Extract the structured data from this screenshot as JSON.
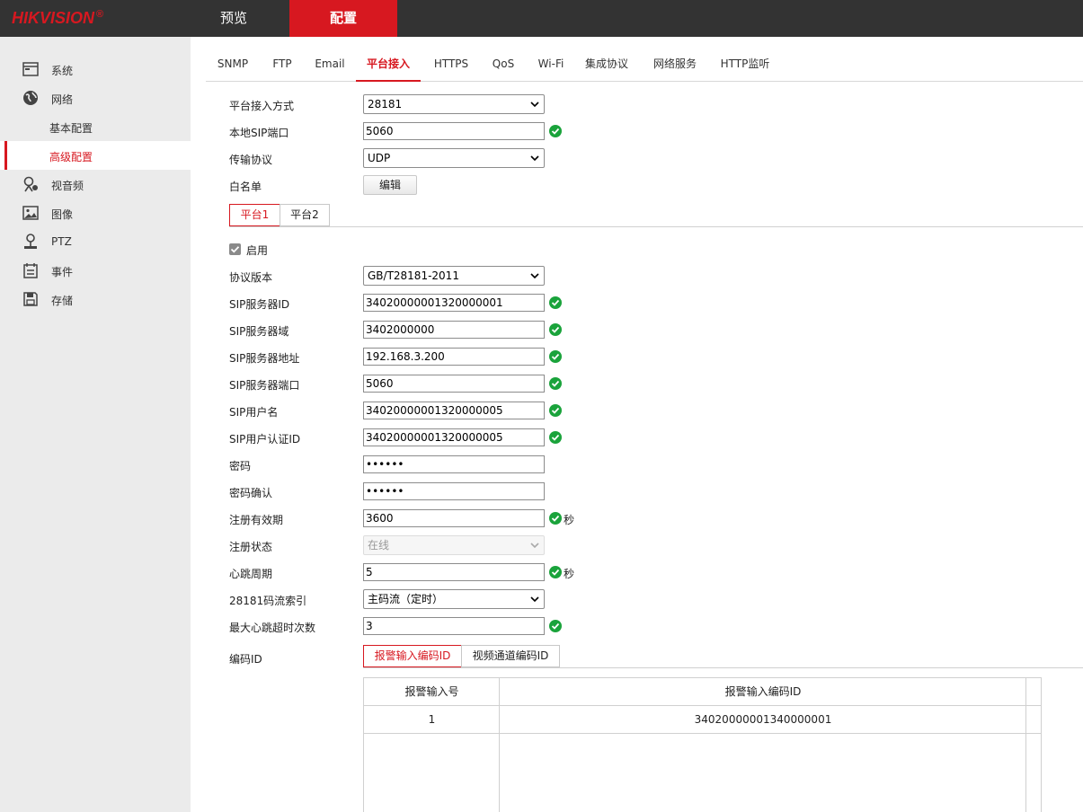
{
  "brand": {
    "logo": "HIKVISION",
    "reg": "®",
    "accent": "#d71820"
  },
  "topnav": {
    "preview": "预览",
    "config": "配置"
  },
  "sidebar": {
    "items": [
      {
        "label": "系统",
        "icon": "system-icon"
      },
      {
        "label": "网络",
        "icon": "network-icon"
      },
      {
        "label": "基本配置",
        "sub": true
      },
      {
        "label": "高级配置",
        "sub": true,
        "active": true
      },
      {
        "label": "视音频",
        "icon": "video-audio-icon"
      },
      {
        "label": "图像",
        "icon": "image-icon"
      },
      {
        "label": "PTZ",
        "icon": "ptz-icon"
      },
      {
        "label": "事件",
        "icon": "event-icon"
      },
      {
        "label": "存储",
        "icon": "storage-icon"
      }
    ]
  },
  "tabs": [
    "SNMP",
    "FTP",
    "Email",
    "平台接入",
    "HTTPS",
    "QoS",
    "Wi-Fi",
    "集成协议",
    "网络服务",
    "HTTP监听"
  ],
  "active_tab": "平台接入",
  "form": {
    "access_mode": {
      "label": "平台接入方式",
      "value": "28181"
    },
    "local_sip_port": {
      "label": "本地SIP端口",
      "value": "5060"
    },
    "transport": {
      "label": "传输协议",
      "value": "UDP"
    },
    "whitelist": {
      "label": "白名单",
      "button": "编辑"
    },
    "platform_tabs": [
      "平台1",
      "平台2"
    ],
    "enable": {
      "label": "启用",
      "checked": true
    },
    "protocol_version": {
      "label": "协议版本",
      "value": "GB/T28181-2011"
    },
    "sip_server_id": {
      "label": "SIP服务器ID",
      "value": "34020000001320000001"
    },
    "sip_server_domain": {
      "label": "SIP服务器域",
      "value": "3402000000"
    },
    "sip_server_addr": {
      "label": "SIP服务器地址",
      "value": "192.168.3.200"
    },
    "sip_server_port": {
      "label": "SIP服务器端口",
      "value": "5060"
    },
    "sip_username": {
      "label": "SIP用户名",
      "value": "34020000001320000005"
    },
    "sip_auth_id": {
      "label": "SIP用户认证ID",
      "value": "34020000001320000005"
    },
    "password": {
      "label": "密码",
      "value": "••••••"
    },
    "password_confirm": {
      "label": "密码确认",
      "value": "••••••"
    },
    "reg_expiry": {
      "label": "注册有效期",
      "value": "3600",
      "unit": "秒"
    },
    "reg_status": {
      "label": "注册状态",
      "value": "在线"
    },
    "heartbeat": {
      "label": "心跳周期",
      "value": "5",
      "unit": "秒"
    },
    "stream_index": {
      "label": "28181码流索引",
      "value": "主码流（定时）"
    },
    "max_heartbeat_timeout": {
      "label": "最大心跳超时次数",
      "value": "3"
    },
    "encode_id": {
      "label": "编码ID",
      "tabs": [
        "报警输入编码ID",
        "视频通道编码ID"
      ]
    }
  },
  "table": {
    "headers": [
      "报警输入号",
      "报警输入编码ID"
    ],
    "rows": [
      [
        "1",
        "34020000001340000001"
      ]
    ]
  }
}
